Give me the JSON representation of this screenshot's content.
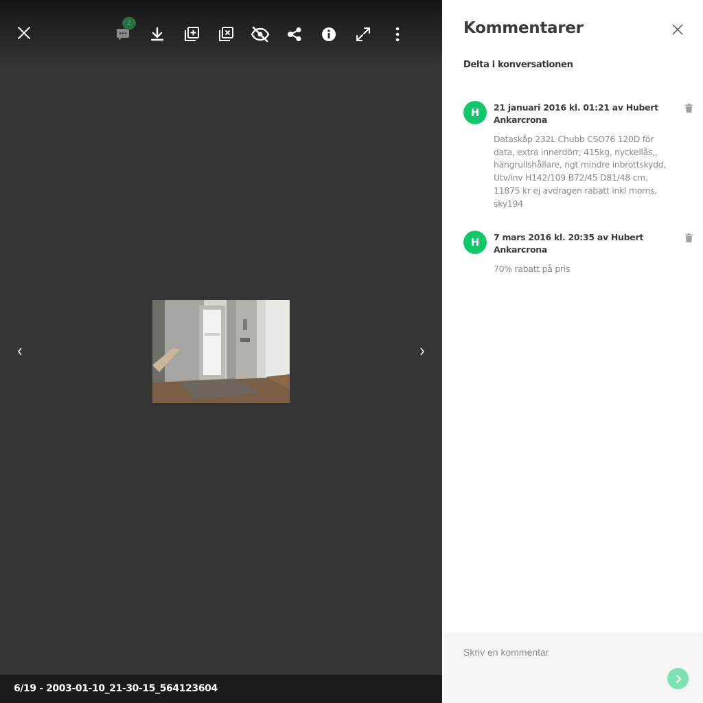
{
  "viewer": {
    "toolbar": {
      "close": "close-icon",
      "comments": {
        "icon": "comment-icon",
        "badge": "2"
      },
      "download": "download-icon",
      "add_to_album": "add-to-album-icon",
      "remove_from_album": "remove-from-album-icon",
      "hide": "hide-icon",
      "share": "share-icon",
      "info": "info-icon",
      "fullscreen": "fullscreen-icon",
      "more": "more-options-icon"
    },
    "nav": {
      "prev": "chevron-left-icon",
      "next": "chevron-right-icon"
    },
    "footer": {
      "caption": "6/19 - 2003-01-10_21-30-15_564123604"
    }
  },
  "panel": {
    "title": "Kommentarer",
    "subtitle": "Delta i konversationen",
    "comments": [
      {
        "avatar": "H",
        "header": "21 januari 2016 kl. 01:21 av Hubert Ankarcrona",
        "body": "Dataskåp 232L Chubb CSO76 120D för data, extra innerdörr, 415kg, nyckellås,, hängrullshållare, ngt mindre inbrottskydd, Utv/inv H142/109 B72/45 D81/48 cm, 11875 kr ej avdragen rabatt inkl moms, sky194"
      },
      {
        "avatar": "H",
        "header": "7 mars 2016 kl. 20:35 av Hubert Ankarcrona",
        "body": "70% rabatt på pris"
      }
    ],
    "composer": {
      "placeholder": "Skriv en kommentar"
    }
  },
  "colors": {
    "viewer_bg": "#353535",
    "footer_bg": "#1b1b1b",
    "avatar": "#12c76b",
    "send_button": "#7ee1b4",
    "badge": "#2a6e48"
  }
}
